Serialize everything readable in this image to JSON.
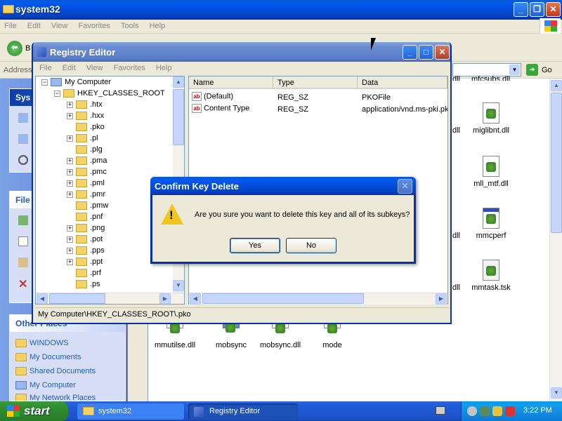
{
  "explorer": {
    "title": "system32",
    "menu": [
      "File",
      "Edit",
      "View",
      "Favorites",
      "Tools",
      "Help"
    ],
    "back_label": "B",
    "address_label": "Address",
    "go_label": "Go",
    "task_sections": [
      {
        "title": "Sys"
      },
      {
        "title": "File"
      }
    ],
    "other_places": {
      "title": "Other Places",
      "items": [
        "WINDOWS",
        "My Documents",
        "Shared Documents",
        "My Computer",
        "My Network Places"
      ]
    },
    "files_top_cut": [
      "mfcsubs.dll"
    ],
    "files": [
      {
        "name": "miglibnt.dll"
      },
      {
        "name": "mll_mtf.dll"
      },
      {
        "name": "mmcperf"
      },
      {
        "name": "mmtask.tsk"
      },
      {
        "name": "mmutilse.dll"
      },
      {
        "name": "mobsync"
      },
      {
        "name": "mobsync.dll"
      },
      {
        "name": "mode"
      }
    ],
    "partial_labels": [
      "dll",
      "dll",
      "dll",
      "dll"
    ]
  },
  "regedit": {
    "title": "Registry Editor",
    "menu": [
      "File",
      "Edit",
      "View",
      "Favorites",
      "Help"
    ],
    "tree": {
      "root": "My Computer",
      "hive": "HKEY_CLASSES_ROOT",
      "keys": [
        {
          "name": ".htx",
          "expand": true
        },
        {
          "name": ".hxx",
          "expand": true
        },
        {
          "name": ".pko",
          "expand": false
        },
        {
          "name": ".pl",
          "expand": true
        },
        {
          "name": ".plg",
          "expand": false
        },
        {
          "name": ".pma",
          "expand": true
        },
        {
          "name": ".pmc",
          "expand": true
        },
        {
          "name": ".pml",
          "expand": true
        },
        {
          "name": ".pmr",
          "expand": true
        },
        {
          "name": ".pmw",
          "expand": false
        },
        {
          "name": ".pnf",
          "expand": false
        },
        {
          "name": ".png",
          "expand": true
        },
        {
          "name": ".pot",
          "expand": true
        },
        {
          "name": ".pps",
          "expand": true
        },
        {
          "name": ".ppt",
          "expand": true
        },
        {
          "name": ".prf",
          "expand": false
        },
        {
          "name": ".ps",
          "expand": false
        }
      ]
    },
    "columns": [
      "Name",
      "Type",
      "Data"
    ],
    "values": [
      {
        "name": "(Default)",
        "type": "REG_SZ",
        "data": "PKOFile"
      },
      {
        "name": "Content Type",
        "type": "REG_SZ",
        "data": "application/vnd.ms-pki.pk"
      }
    ],
    "status": "My Computer\\HKEY_CLASSES_ROOT\\.pko"
  },
  "dialog": {
    "title": "Confirm Key Delete",
    "message": "Are you sure you want to delete this key and all of its subkeys?",
    "yes_label": "Yes",
    "no_label": "No"
  },
  "taskbar": {
    "start_label": "start",
    "tasks": [
      "system32",
      "Registry Editor"
    ],
    "clock": "3:22 PM"
  }
}
